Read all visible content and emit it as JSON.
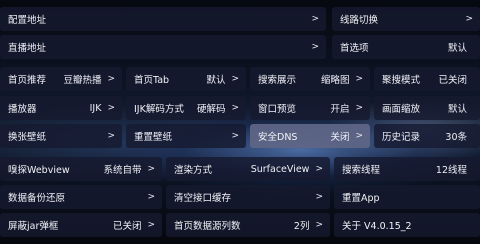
{
  "rows": [
    [
      {
        "label": "配置地址",
        "value": "",
        "arrow": ">"
      },
      {
        "label": "线路切换",
        "value": "",
        "arrow": ">"
      }
    ],
    [
      {
        "label": "直播地址",
        "value": "",
        "arrow": ">"
      },
      {
        "label": "首选项",
        "value": "默认",
        "arrow": ""
      }
    ],
    [
      {
        "label": "首页推荐",
        "value": "豆瓣热播",
        "arrow": ">"
      },
      {
        "label": "首页Tab",
        "value": "默认",
        "arrow": ">"
      },
      {
        "label": "搜索展示",
        "value": "缩略图",
        "arrow": ">"
      },
      {
        "label": "聚搜模式",
        "value": "已关闭",
        "arrow": ""
      }
    ],
    [
      {
        "label": "播放器",
        "value": "IJK",
        "arrow": ">"
      },
      {
        "label": "IJK解码方式",
        "value": "硬解码",
        "arrow": ">"
      },
      {
        "label": "窗口预览",
        "value": "开启",
        "arrow": ">"
      },
      {
        "label": "画面缩放",
        "value": "默认",
        "arrow": ""
      }
    ],
    [
      {
        "label": "换张壁纸",
        "value": "",
        "arrow": ">"
      },
      {
        "label": "重置壁纸",
        "value": "",
        "arrow": ">"
      },
      {
        "label": "安全DNS",
        "value": "关闭",
        "arrow": ">"
      },
      {
        "label": "历史记录",
        "value": "30条",
        "arrow": ""
      }
    ],
    [
      {
        "label": "嗅探Webview",
        "value": "系统自带",
        "arrow": ">"
      },
      {
        "label": "渲染方式",
        "value": "SurfaceView",
        "arrow": ">"
      },
      {
        "label": "搜索线程",
        "value": "12线程",
        "arrow": ""
      }
    ],
    [
      {
        "label": "数据备份还原",
        "value": "",
        "arrow": ">"
      },
      {
        "label": "清空接口缓存",
        "value": "",
        "arrow": ">"
      },
      {
        "label": "重置App",
        "value": "",
        "arrow": ""
      }
    ],
    [
      {
        "label": "屏蔽jar弹框",
        "value": "已关闭",
        "arrow": ">"
      },
      {
        "label": "首页数据源列数",
        "value": "2列",
        "arrow": ">"
      },
      {
        "label": "关于  V4.0.15_2",
        "value": "",
        "arrow": ""
      }
    ]
  ]
}
